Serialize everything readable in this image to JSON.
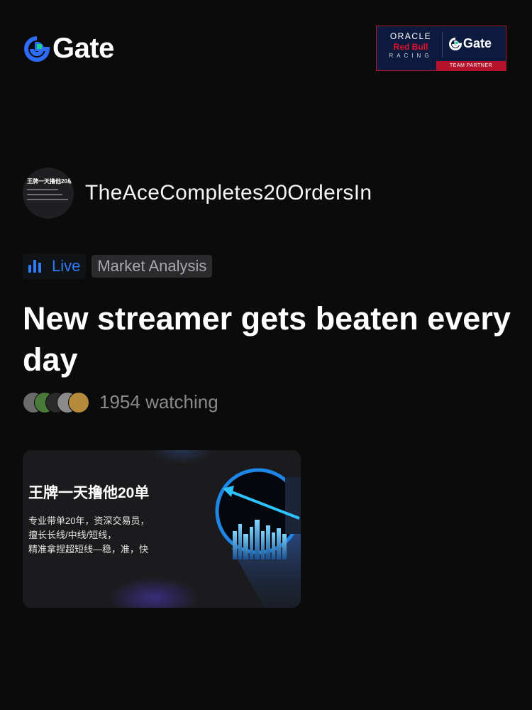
{
  "header": {
    "logo_text": "Gate",
    "partner": {
      "oracle": "ORACLE",
      "redbull": "Red Bull",
      "racing": "RACING",
      "gate_text": "Gate",
      "strip": "TEAM PARTNER"
    }
  },
  "streamer": {
    "name": "TheAceCompletes20OrdersIn",
    "avatar_title": "王牌一天撸他20单"
  },
  "tags": {
    "live": "Live",
    "category": "Market Analysis"
  },
  "stream_title": "New streamer gets beaten every day",
  "viewers": {
    "count_text": "1954 watching",
    "avatar_colors": [
      "#6b6b6b",
      "#4a7a3a",
      "#2a2a2a",
      "#8a8a8a",
      "#b58a3a"
    ]
  },
  "thumbnail": {
    "title": "王牌一天撸他20单",
    "lines": [
      "专业带单20年，资深交易员，",
      "擅长长线/中线/短线，",
      "精准拿捏超短线—稳，准，快"
    ]
  },
  "colors": {
    "accent_blue": "#2f7cf6",
    "brand_green": "#18d28c",
    "partner_red": "#b3142b",
    "background": "#0b0b0c"
  }
}
